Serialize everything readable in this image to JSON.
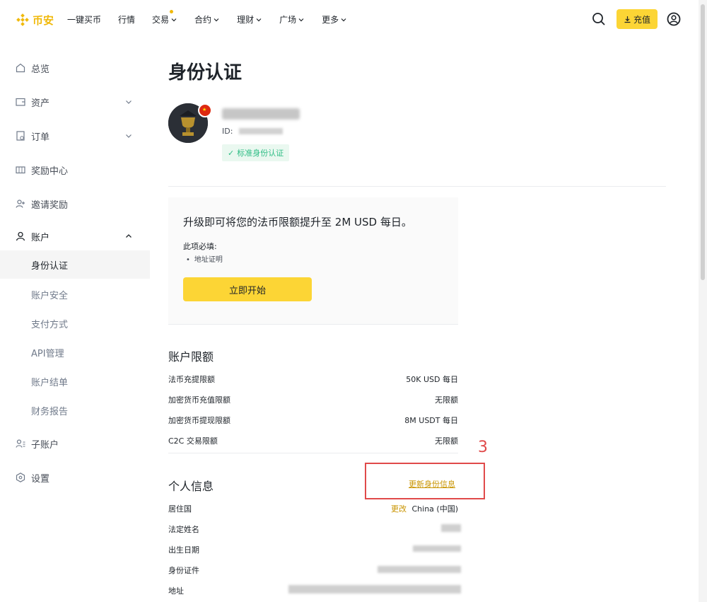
{
  "brand": {
    "name": "币安",
    "color": "#f0b90b"
  },
  "nav": {
    "items": [
      {
        "label": "一键买币",
        "dropdown": false
      },
      {
        "label": "行情",
        "dropdown": false
      },
      {
        "label": "交易",
        "dropdown": true,
        "dot": true
      },
      {
        "label": "合约",
        "dropdown": true
      },
      {
        "label": "理财",
        "dropdown": true
      },
      {
        "label": "广场",
        "dropdown": true
      },
      {
        "label": "更多",
        "dropdown": true
      }
    ],
    "deposit_label": "充值"
  },
  "sidebar": {
    "items": [
      {
        "label": "总览",
        "icon": "home-icon"
      },
      {
        "label": "资产",
        "icon": "wallet-icon",
        "expand": "down"
      },
      {
        "label": "订单",
        "icon": "orders-icon",
        "expand": "down"
      },
      {
        "label": "奖励中心",
        "icon": "ticket-icon"
      },
      {
        "label": "邀请奖励",
        "icon": "add-user-icon"
      },
      {
        "label": "账户",
        "icon": "person-icon",
        "expand": "up"
      }
    ],
    "sub_items": [
      "身份认证",
      "账户安全",
      "支付方式",
      "API管理",
      "账户结单",
      "财务报告"
    ],
    "bottom_items": [
      {
        "label": "子账户",
        "icon": "sub-account-icon"
      },
      {
        "label": "设置",
        "icon": "settings-icon"
      }
    ]
  },
  "main": {
    "title": "身份认证",
    "profile": {
      "id_label": "ID:",
      "kyc_badge": "标准身份认证"
    },
    "upgrade": {
      "heading": "升级即可将您的法币限额提升至 2M USD 每日。",
      "required_label": "此项必填:",
      "required_item": "地址证明",
      "start_button": "立即开始"
    },
    "limits": {
      "title": "账户限额",
      "rows": [
        {
          "label": "法币充提限额",
          "value": "50K USD 每日"
        },
        {
          "label": "加密货币充值限额",
          "value": "无限额"
        },
        {
          "label": "加密货币提现限额",
          "value": "8M USDT 每日"
        },
        {
          "label": "C2C 交易限额",
          "value": "无限额"
        }
      ]
    },
    "personal": {
      "title": "个人信息",
      "update_link": "更新身份信息",
      "change_link": "更改",
      "rows": [
        {
          "label": "居住国",
          "value": "China (中国)"
        },
        {
          "label": "法定姓名",
          "value": ""
        },
        {
          "label": "出生日期",
          "value": ""
        },
        {
          "label": "身份证件",
          "value": ""
        },
        {
          "label": "地址",
          "value": ""
        }
      ]
    },
    "annotation": "3"
  },
  "colors": {
    "accent": "#fcd535",
    "link": "#c99400",
    "success": "#2ebd85",
    "annotation": "#e04a4a"
  }
}
